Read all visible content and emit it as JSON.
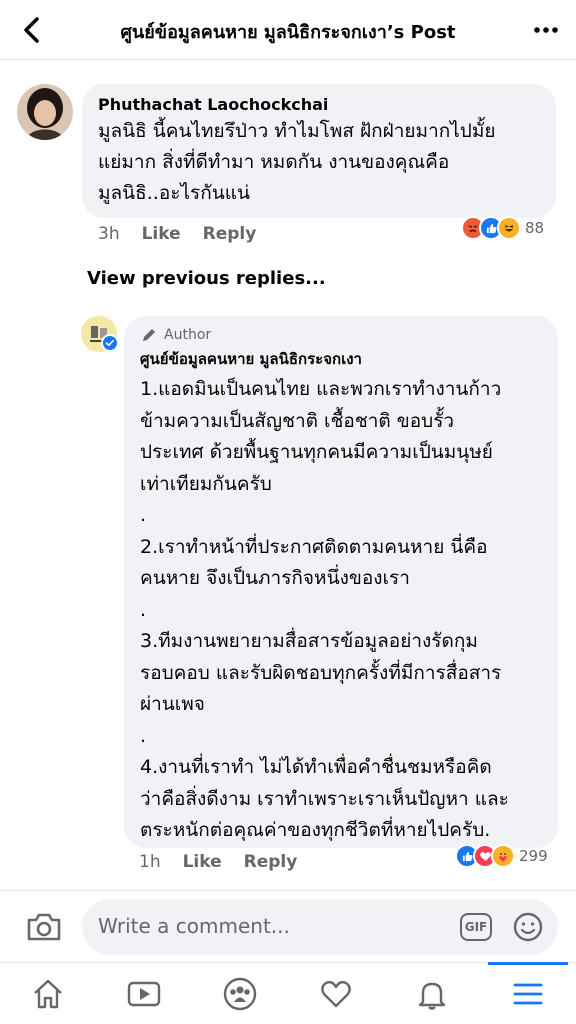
{
  "header": {
    "title": "ศูนย์ข้อมูลคนหาย มูลนิธิกระจกเงา’s Post"
  },
  "comment": {
    "author": "Phuthachat Laochockchai",
    "text": "มูลนิธิ นี้คนไทยรึป่าว ทำไมโพส ฝักฝ่ายมากไปมั้ย\nแย่มาก สิ่งที่ดีทำมา หมดกัน งานของคุณคือ\nมูลนิธิ..อะไรกันแน่",
    "time": "3h",
    "like_label": "Like",
    "reply_label": "Reply",
    "reaction_count": "88",
    "reactions": [
      "angry-reaction-icon",
      "like-reaction-icon",
      "haha-reaction-icon"
    ]
  },
  "view_previous": "View previous replies...",
  "reply": {
    "badge": "Author",
    "author": "ศูนย์ข้อมูลคนหาย มูลนิธิกระจกเงา",
    "text": "1.แอดมินเป็นคนไทย และพวกเราทำงานก้าว\nข้ามความเป็นสัญชาติ เชื้อชาติ ขอบรั้ว\nประเทศ ด้วยพื้นฐานทุกคนมีความเป็นมนุษย์\nเท่าเทียมกันครับ\n.\n2.เราทำหน้าที่ประกาศติดตามคนหาย นี่คือ\nคนหาย จึงเป็นภารกิจหนึ่งของเรา\n.\n3.ทีมงานพยายามสื่อสารข้อมูลอย่างรัดกุม\nรอบคอบ และรับผิดชอบทุกครั้งที่มีการสื่อสาร\nผ่านเพจ\n.\n4.งานที่เราทำ ไม่ได้ทำเพื่อคำชื่นชมหรือคิด\nว่าคือสิ่งดีงาม เราทำเพราะเราเห็นปัญหา และ\nตระหนักต่อคุณค่าของทุกชีวิตที่หายไปครับ.",
    "time": "1h",
    "like_label": "Like",
    "reply_label": "Reply",
    "reaction_count": "299",
    "reactions": [
      "like-reaction-icon",
      "love-reaction-icon",
      "care-reaction-icon"
    ]
  },
  "composer": {
    "placeholder": "Write a comment...",
    "gif_label": "GIF"
  },
  "tabs": [
    {
      "name": "home-icon"
    },
    {
      "name": "watch-icon"
    },
    {
      "name": "groups-icon"
    },
    {
      "name": "dating-heart-icon"
    },
    {
      "name": "notifications-bell-icon"
    },
    {
      "name": "menu-icon",
      "active": true
    }
  ],
  "colors": {
    "accent": "#1877f2",
    "bubble": "#f0f2f5",
    "muted": "#65676b",
    "angry": "#f0583b",
    "love": "#f33e58",
    "haha": "#f7b125"
  }
}
